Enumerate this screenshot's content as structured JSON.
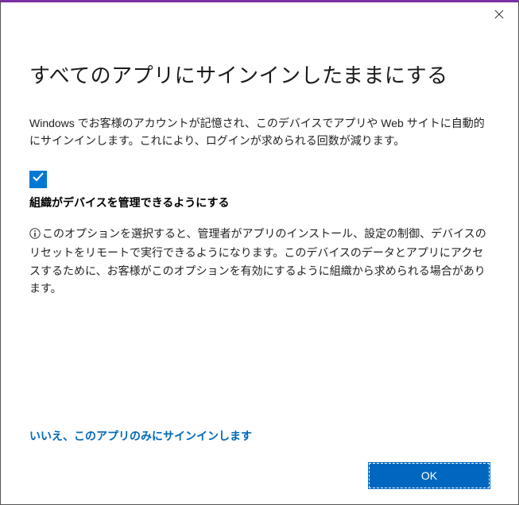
{
  "window": {
    "close_icon": "close"
  },
  "main": {
    "title": "すべてのアプリにサインインしたままにする",
    "description": "Windows でお客様のアカウントが記憶され、このデバイスでアプリや Web サイトに自動的にサインインします。これにより、ログインが求められる回数が減ります。",
    "checkbox": {
      "checked": true,
      "label": "組織がデバイスを管理できるようにする"
    },
    "info_text": "このオプションを選択すると、管理者がアプリのインストール、設定の制御、デバイスのリセットをリモートで実行できるようになります。このデバイスのデータとアプリにアクセスするために、お客様がこのオプションを有効にするように組織から求められる場合があります。",
    "link": "いいえ、このアプリのみにサインインします",
    "ok_button": "OK"
  },
  "colors": {
    "accent": "#0078d4",
    "link": "#0067b8",
    "button": "#0067c0",
    "titlebar_border": "#7b2ea3"
  }
}
